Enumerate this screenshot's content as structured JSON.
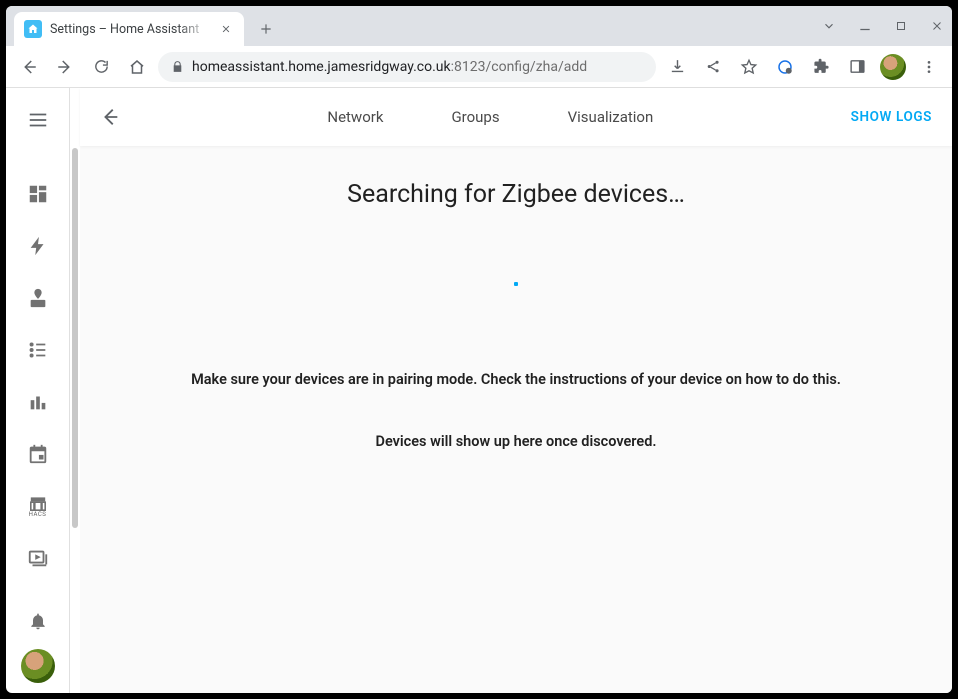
{
  "browser": {
    "tab_title": "Settings – Home Assistant",
    "url_host": "homeassistant.home.jamesridgway.co.uk",
    "url_port_path": ":8123/config/zha/add"
  },
  "colors": {
    "accent": "#03a9f4",
    "favicon_bg": "#41bdf5"
  },
  "sidebar": {
    "items": [
      {
        "name": "overview"
      },
      {
        "name": "energy"
      },
      {
        "name": "map"
      },
      {
        "name": "logbook"
      },
      {
        "name": "history"
      },
      {
        "name": "calendar"
      },
      {
        "name": "hacs",
        "label": "HACS"
      },
      {
        "name": "media"
      }
    ]
  },
  "header": {
    "tabs": [
      {
        "label": "Network"
      },
      {
        "label": "Groups"
      },
      {
        "label": "Visualization"
      }
    ],
    "show_logs": "SHOW LOGS"
  },
  "page": {
    "title": "Searching for Zigbee devices…",
    "instruction1": "Make sure your devices are in pairing mode. Check the instructions of your device on how to do this.",
    "instruction2": "Devices will show up here once discovered."
  }
}
